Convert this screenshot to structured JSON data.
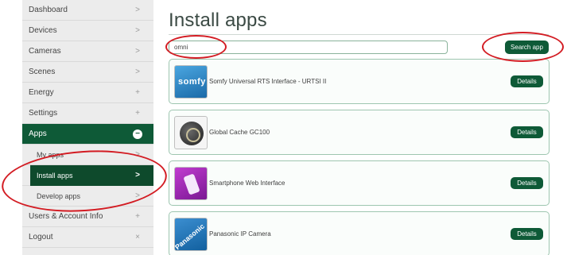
{
  "sidebar": {
    "items": [
      {
        "label": "Dashboard",
        "indicator": ">"
      },
      {
        "label": "Devices",
        "indicator": ">"
      },
      {
        "label": "Cameras",
        "indicator": ">"
      },
      {
        "label": "Scenes",
        "indicator": ">"
      },
      {
        "label": "Energy",
        "indicator": "+"
      },
      {
        "label": "Settings",
        "indicator": "+"
      },
      {
        "label": "Apps",
        "indicator": "−"
      }
    ],
    "sub_items": [
      {
        "label": "My apps",
        "indicator": ">"
      },
      {
        "label": "Install apps",
        "indicator": ">"
      },
      {
        "label": "Develop apps",
        "indicator": ">"
      }
    ],
    "bottom_items": [
      {
        "label": "Users & Account Info",
        "indicator": "+"
      },
      {
        "label": "Logout",
        "indicator": "×"
      }
    ]
  },
  "main": {
    "title": "Install apps",
    "search": {
      "value": "omni",
      "button_label": "Search app"
    },
    "apps": [
      {
        "name": "Somfy Universal RTS Interface - URTSI II",
        "details_label": "Details",
        "thumb_text": "somfy"
      },
      {
        "name": "Global Cache GC100",
        "details_label": "Details"
      },
      {
        "name": "Smartphone Web Interface",
        "details_label": "Details"
      },
      {
        "name": "Panasonic IP Camera",
        "details_label": "Details",
        "thumb_text": "Panasonic"
      }
    ]
  },
  "colors": {
    "accent": "#0e5a37",
    "annotation": "#d31c23"
  }
}
